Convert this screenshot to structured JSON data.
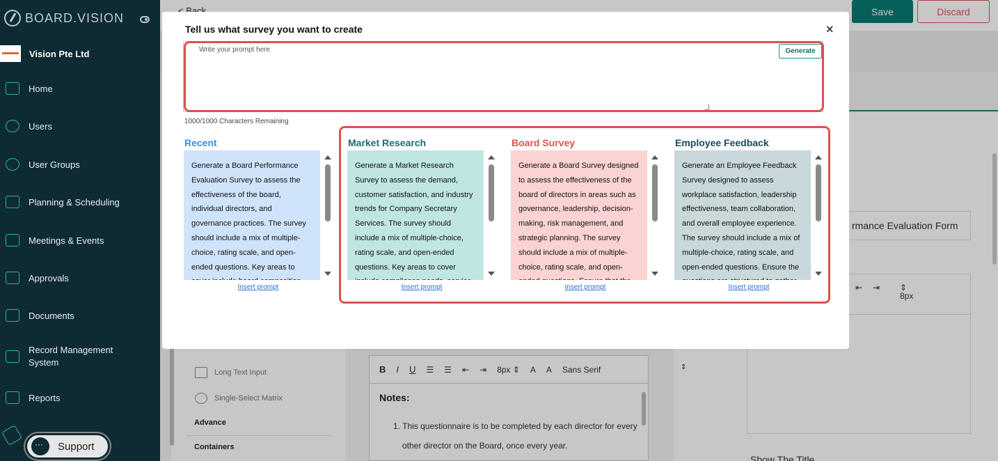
{
  "brand": {
    "name": "BOARD.VISION"
  },
  "company": {
    "name": "Vision Pte Ltd"
  },
  "nav": [
    {
      "label": "Home",
      "icon": "home-icon"
    },
    {
      "label": "Users",
      "icon": "user-icon"
    },
    {
      "label": "User Groups",
      "icon": "user-group-icon"
    },
    {
      "label": "Planning & Scheduling",
      "icon": "chart-bars-icon"
    },
    {
      "label": "Meetings & Events",
      "icon": "calendar-icon"
    },
    {
      "label": "Approvals",
      "icon": "document-icon"
    },
    {
      "label": "Documents",
      "icon": "documents-icon"
    },
    {
      "label": "Record Management System",
      "icon": "record-icon"
    },
    {
      "label": "Reports",
      "icon": "report-icon"
    }
  ],
  "support": {
    "label": "Support"
  },
  "background": {
    "back_label": "< Back",
    "save_label": "Save",
    "discard_label": "Discard",
    "palette": {
      "long_text": "Long Text Input",
      "single_select_matrix": "Single-Select Matrix",
      "advance": "Advance",
      "containers": "Containers"
    },
    "editor": {
      "font_size": "8px",
      "font_family": "Sans Serif",
      "notes_title": "Notes:",
      "note_1a": "1. This questionnaire is to be completed by each director for every",
      "note_1b": "other director on the Board, once every year."
    },
    "form_name_fragment": "rmance Evaluation Form",
    "right_font_size": "8px",
    "show_title": "Show The Title"
  },
  "modal": {
    "title": "Tell us what survey you want to create",
    "close": "×",
    "prompt_placeholder": "Write your prompt here",
    "generate_label": "Generate",
    "chars_remaining": "1000/1000 Characters Remaining",
    "insert_label": "Insert prompt",
    "cards": [
      {
        "title": "Recent",
        "title_color": "#3a8ee6",
        "bg_color": "#cfe3fb",
        "text": "Generate a Board Performance Evaluation Survey to assess the effectiveness of the board, individual directors, and governance practices. The survey should include a mix of multiple-choice, rating scale, and open-ended questions. Key areas to cover include board composition, leadership effectiveness, decision-making processes, and stakeholder engagement."
      },
      {
        "title": "Market Research",
        "title_color": "#1c6b74",
        "bg_color": "#bfe6e2",
        "text": "Generate a Market Research Survey to assess the demand, customer satisfaction, and industry trends for Company Secretary Services. The survey should include a mix of multiple-choice, rating scale, and open-ended questions. Key areas to cover include compliance needs, service quality, pricing expectations and emerging trends."
      },
      {
        "title": "Board Survey",
        "title_color": "#e0524e",
        "bg_color": "#fbd3d3",
        "text": "Generate a Board Survey designed to assess the effectiveness of the board of directors in areas such as governance, leadership, decision-making, risk management, and strategic planning. The survey should include a mix of multiple-choice, rating scale, and open-ended questions. Ensure that the questions are clear and actionable."
      },
      {
        "title": "Employee Feedback",
        "title_color": "#1a4a5a",
        "bg_color": "#c8d8db",
        "text": "Generate an Employee Feedback Survey designed to assess workplace satisfaction, leadership effectiveness, team collaboration, and overall employee experience. The survey should include a mix of multiple-choice, rating scale, and open-ended questions. Ensure the questions are structured to gather insights on engagement and growth."
      }
    ]
  }
}
